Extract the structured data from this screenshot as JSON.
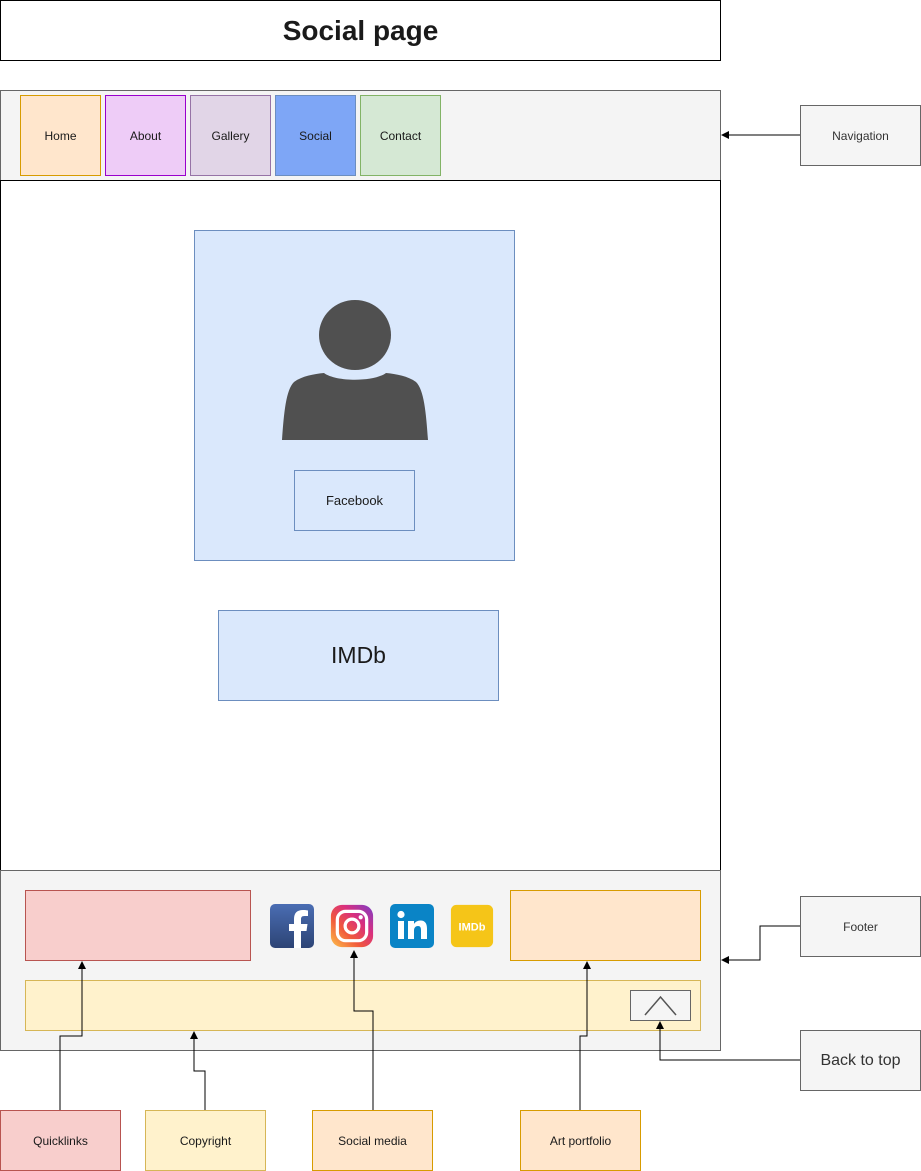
{
  "page": {
    "title": "Social page"
  },
  "nav": {
    "items": [
      {
        "label": "Home"
      },
      {
        "label": "About"
      },
      {
        "label": "Gallery"
      },
      {
        "label": "Social"
      },
      {
        "label": "Contact"
      }
    ]
  },
  "main": {
    "facebook_label": "Facebook",
    "imdb_label": "IMDb",
    "avatar_icon": "user-silhouette-icon"
  },
  "footer": {
    "social_icons": [
      {
        "name": "facebook-icon",
        "color": "#3b5998"
      },
      {
        "name": "instagram-icon",
        "color": "#c13584"
      },
      {
        "name": "linkedin-icon",
        "color": "#0077b5"
      },
      {
        "name": "imdb-icon",
        "color": "#f5c518",
        "text": "IMDb"
      }
    ],
    "back_to_top_icon": "chevron-up-icon"
  },
  "annotations": {
    "navigation": "Navigation",
    "footer": "Footer",
    "back_to_top": "Back to top",
    "quicklinks": "Quicklinks",
    "copyright": "Copyright",
    "social_media": "Social media",
    "art_portfolio": "Art portfolio"
  }
}
